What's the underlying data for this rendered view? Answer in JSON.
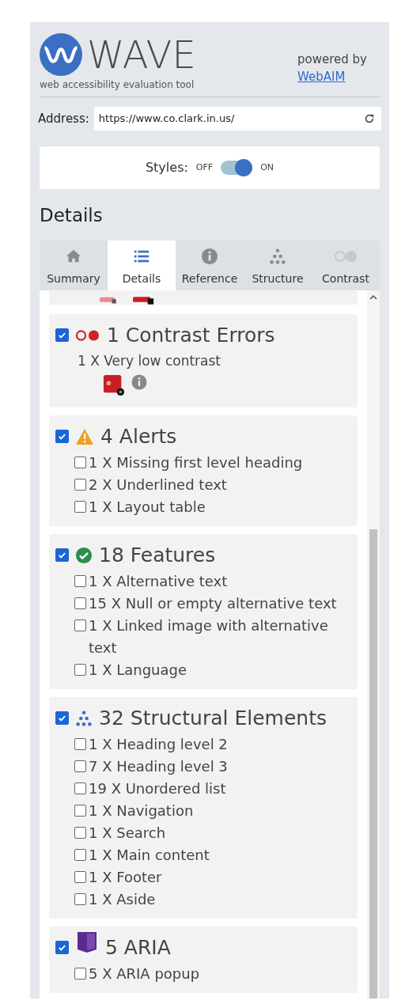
{
  "header": {
    "logo_text": "WAVE",
    "tagline": "web accessibility evaluation tool",
    "powered_by": "powered by",
    "link": "WebAIM"
  },
  "address": {
    "label": "Address:",
    "value": "https://www.co.clark.in.us/"
  },
  "styles": {
    "label": "Styles:",
    "off": "OFF",
    "on_label": "ON",
    "on": true
  },
  "heading": "Details",
  "tabs": [
    {
      "label": "Summary",
      "kind": "home",
      "selected": false
    },
    {
      "label": "Details",
      "kind": "list",
      "selected": true
    },
    {
      "label": "Reference",
      "kind": "info",
      "selected": false
    },
    {
      "label": "Structure",
      "kind": "tree",
      "selected": false
    },
    {
      "label": "Contrast",
      "kind": "contrast",
      "selected": false
    }
  ],
  "sections": [
    {
      "kind": "contrast",
      "checked": true,
      "title": "1 Contrast Errors",
      "items": [
        {
          "label": "1 X Very low contrast"
        }
      ]
    },
    {
      "kind": "alert",
      "checked": true,
      "title": "4 Alerts",
      "items": [
        {
          "label": "1 X Missing first level heading",
          "checked": false
        },
        {
          "label": "2 X Underlined text",
          "checked": false
        },
        {
          "label": "1 X Layout table",
          "checked": false
        }
      ]
    },
    {
      "kind": "feature",
      "checked": true,
      "title": "18 Features",
      "items": [
        {
          "label": "1 X Alternative text",
          "checked": false
        },
        {
          "label": "15 X Null or empty alternative text",
          "checked": false
        },
        {
          "label": "1 X Linked image with alternative text",
          "checked": false
        },
        {
          "label": "1 X Language",
          "checked": false
        }
      ]
    },
    {
      "kind": "structure",
      "checked": true,
      "title": "32 Structural Elements",
      "items": [
        {
          "label": "1 X Heading level 2",
          "checked": false
        },
        {
          "label": "7 X Heading level 3",
          "checked": false
        },
        {
          "label": "19 X Unordered list",
          "checked": false
        },
        {
          "label": "1 X Navigation",
          "checked": false
        },
        {
          "label": "1 X Search",
          "checked": false
        },
        {
          "label": "1 X Main content",
          "checked": false
        },
        {
          "label": "1 X Footer",
          "checked": false
        },
        {
          "label": "1 X Aside",
          "checked": false
        }
      ]
    },
    {
      "kind": "aria",
      "checked": true,
      "title": "5 ARIA",
      "items": [
        {
          "label": "5 X ARIA popup",
          "checked": false
        }
      ]
    }
  ]
}
